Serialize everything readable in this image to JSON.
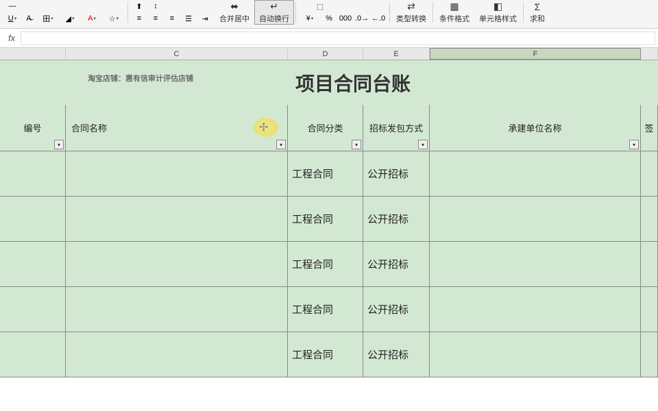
{
  "ribbon": {
    "merge_label": "合并居中",
    "wrap_label": "自动换行",
    "type_convert": "类型转换",
    "cond_format": "条件格式",
    "cell_style": "单元格样式",
    "sum": "求和"
  },
  "formula": {
    "fx": "fx",
    "value": ""
  },
  "columns": {
    "C": "C",
    "D": "D",
    "E": "E",
    "F": "F"
  },
  "sheet": {
    "title": "项目合同台账",
    "watermark": "淘宝店铺：惠有信审计评估店铺",
    "headers": {
      "B": "编号",
      "C": "合同名称",
      "D": "合同分类",
      "E": "招标发包方式",
      "F": "承建单位名称",
      "G": "签"
    },
    "rows": [
      {
        "D": "工程合同",
        "E": "公开招标"
      },
      {
        "D": "工程合同",
        "E": "公开招标"
      },
      {
        "D": "工程合同",
        "E": "公开招标"
      },
      {
        "D": "工程合同",
        "E": "公开招标"
      },
      {
        "D": "工程合同",
        "E": "公开招标"
      }
    ]
  }
}
